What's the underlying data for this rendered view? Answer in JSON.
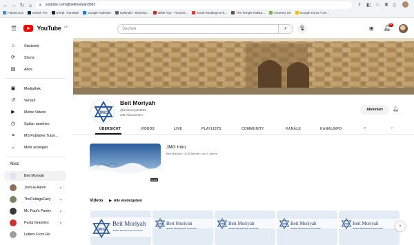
{
  "browser": {
    "url": "youtube.com/@beitmoriyah3563",
    "bookmarks": [
      {
        "label": "Fabcal.com",
        "color": "#4285f4"
      },
      {
        "label": "Deepl. Pro",
        "color": "#0f2b46"
      },
      {
        "label": "Deepl. Translate",
        "color": "#0f2b46"
      },
      {
        "label": "Google Kalender",
        "color": "#1a73e8"
      },
      {
        "label": "Kalender - Beit Mor...",
        "color": "#5f6368"
      },
      {
        "label": "Bible App - Youvers...",
        "color": "#c62828"
      },
      {
        "label": "Torah Readings 576...",
        "color": "#e53935"
      },
      {
        "label": "The Temple Institut...",
        "color": "#6d4c41"
      },
      {
        "label": "Ancestry UK",
        "color": "#7cb342"
      },
      {
        "label": "Google Konto / Om...",
        "color": "#fbbc05"
      }
    ]
  },
  "masthead": {
    "logo_text": "YouTube",
    "country_code": "CH",
    "search_placeholder": "Suchen",
    "notification_count": "9+"
  },
  "sidebar": {
    "top": [
      {
        "label": "Startseite",
        "icon": "home-icon",
        "glyph": "⌂"
      },
      {
        "label": "Shorts",
        "icon": "shorts-icon",
        "glyph": "⟳"
      },
      {
        "label": "Abos",
        "icon": "subscriptions-icon",
        "glyph": "▤"
      }
    ],
    "library": [
      {
        "label": "Mediathek",
        "icon": "library-icon",
        "glyph": "▣"
      },
      {
        "label": "Verlauf",
        "icon": "history-icon",
        "glyph": "↺"
      },
      {
        "label": "Meine Videos",
        "icon": "your-videos-icon",
        "glyph": "▶"
      },
      {
        "label": "Später ansehen",
        "icon": "watch-later-icon",
        "glyph": "◷"
      },
      {
        "label": "MS Publisher Tutori...",
        "icon": "playlist-icon",
        "glyph": "≡"
      },
      {
        "label": "Mehr anzeigen",
        "icon": "chevron-down-icon",
        "glyph": "⌄"
      }
    ],
    "subs_heading": "Abos",
    "subscriptions": [
      {
        "label": "Beit Moriyah",
        "color": "#dfe6f3",
        "active": true,
        "dot": false
      },
      {
        "label": "Joshua Aaron",
        "color": "#8b6f5a",
        "active": false,
        "dot": true
      },
      {
        "label": "TheCottageFairy",
        "color": "#6f8a5d",
        "active": false,
        "dot": true
      },
      {
        "label": "Mr. Paul's Pantry",
        "color": "#3b3b3b",
        "active": false,
        "dot": true
      },
      {
        "label": "Pasta Grannies",
        "color": "#d32f2f",
        "active": false,
        "dot": true
      },
      {
        "label": "Letters From Ro",
        "color": "#9e9e9e",
        "active": false,
        "dot": false
      }
    ]
  },
  "channel": {
    "name": "Beit Moriyah",
    "handle": "@beitmoriyah3563",
    "subscribers": "246 Abonnenten",
    "subscribe_label": "Abonniert",
    "avatar_text": "JMG"
  },
  "tabs": [
    "ÜBERSICHT",
    "VIDEOS",
    "LIVE",
    "PLAYLISTS",
    "COMMUNITY",
    "KANÄLE",
    "KANALINFO"
  ],
  "featured": {
    "title": "JMG Intro",
    "meta": "Beit Moriyah • 1135 Aufrufe • vor 4 Jahren",
    "duration": "0:23"
  },
  "shelf": {
    "heading": "Videos",
    "play_all": "Alle wiedergeben",
    "cards": [
      {
        "title": "Beit Moriyah",
        "subtitle": "Jüdisch Messianische Gemeinde"
      },
      {
        "title": "Beit Moriyah",
        "subtitle": "Jüdisch Messianische Gemeinde"
      },
      {
        "title": "Beit Moriyah",
        "subtitle": "Jüdisch Messianische Gemeinde"
      },
      {
        "title": "Beit Moriyah",
        "subtitle": "Jüdisch Messianische Gemeinde"
      },
      {
        "title": "Beit Moriyah",
        "subtitle": "Jüdisch Messianische Gemeinde"
      }
    ]
  }
}
